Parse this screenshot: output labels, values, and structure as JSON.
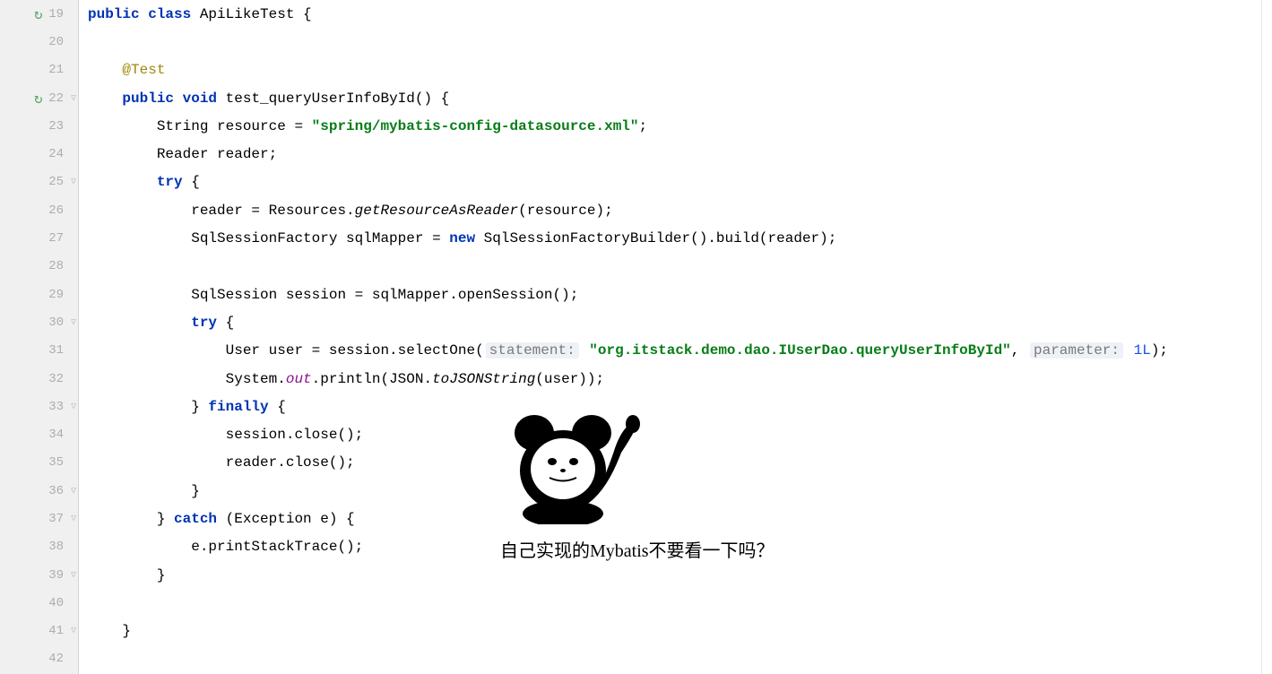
{
  "lines": [
    {
      "n": 19,
      "run": true,
      "fold": false
    },
    {
      "n": 20,
      "run": false,
      "fold": false
    },
    {
      "n": 21,
      "run": false,
      "fold": false
    },
    {
      "n": 22,
      "run": true,
      "fold": true
    },
    {
      "n": 23,
      "run": false,
      "fold": false
    },
    {
      "n": 24,
      "run": false,
      "fold": false
    },
    {
      "n": 25,
      "run": false,
      "fold": true
    },
    {
      "n": 26,
      "run": false,
      "fold": false
    },
    {
      "n": 27,
      "run": false,
      "fold": false
    },
    {
      "n": 28,
      "run": false,
      "fold": false
    },
    {
      "n": 29,
      "run": false,
      "fold": false
    },
    {
      "n": 30,
      "run": false,
      "fold": true
    },
    {
      "n": 31,
      "run": false,
      "fold": false
    },
    {
      "n": 32,
      "run": false,
      "fold": false
    },
    {
      "n": 33,
      "run": false,
      "fold": true
    },
    {
      "n": 34,
      "run": false,
      "fold": false
    },
    {
      "n": 35,
      "run": false,
      "fold": false
    },
    {
      "n": 36,
      "run": false,
      "fold": true
    },
    {
      "n": 37,
      "run": false,
      "fold": true
    },
    {
      "n": 38,
      "run": false,
      "fold": false
    },
    {
      "n": 39,
      "run": false,
      "fold": true
    },
    {
      "n": 40,
      "run": false,
      "fold": false
    },
    {
      "n": 41,
      "run": false,
      "fold": true
    },
    {
      "n": 42,
      "run": false,
      "fold": false
    }
  ],
  "code": {
    "t19_1": "public class",
    "t19_2": " ApiLikeTest {",
    "t21_1": "    @Test",
    "t22_1": "    ",
    "t22_2": "public void",
    "t22_3": " test_queryUserInfoById() {",
    "t23_1": "        String resource = ",
    "t23_2": "\"spring/mybatis-config-datasource.xml\"",
    "t23_3": ";",
    "t24_1": "        Reader reader;",
    "t25_1": "        ",
    "t25_2": "try",
    "t25_3": " {",
    "t26_1": "            reader = Resources.",
    "t26_2": "getResourceAsReader",
    "t26_3": "(resource);",
    "t27_1": "            SqlSessionFactory sqlMapper = ",
    "t27_2": "new",
    "t27_3": " SqlSessionFactoryBuilder().build(reader);",
    "t29_1": "            SqlSession session = sqlMapper.openSession();",
    "t30_1": "            ",
    "t30_2": "try",
    "t30_3": " {",
    "t31_1": "                User user = session.selectOne(",
    "t31_h1": "statement:",
    "t31_2": " ",
    "t31_3": "\"org.itstack.demo.dao.IUserDao.queryUserInfoById\"",
    "t31_4": ", ",
    "t31_h2": "parameter:",
    "t31_5": " ",
    "t31_6": "1L",
    "t31_7": ");",
    "t32_1": "                System.",
    "t32_2": "out",
    "t32_3": ".println(JSON.",
    "t32_4": "toJSONString",
    "t32_5": "(user));",
    "t33_1": "            } ",
    "t33_2": "finally",
    "t33_3": " {",
    "t34_1": "                session.close();",
    "t35_1": "                reader.close();",
    "t36_1": "            }",
    "t37_1": "        } ",
    "t37_2": "catch",
    "t37_3": " (Exception e) {",
    "t38_1": "            e.printStackTrace();",
    "t39_1": "        }",
    "t41_1": "    }"
  },
  "meme_text": "自己实现的Mybatis不要看一下吗？"
}
